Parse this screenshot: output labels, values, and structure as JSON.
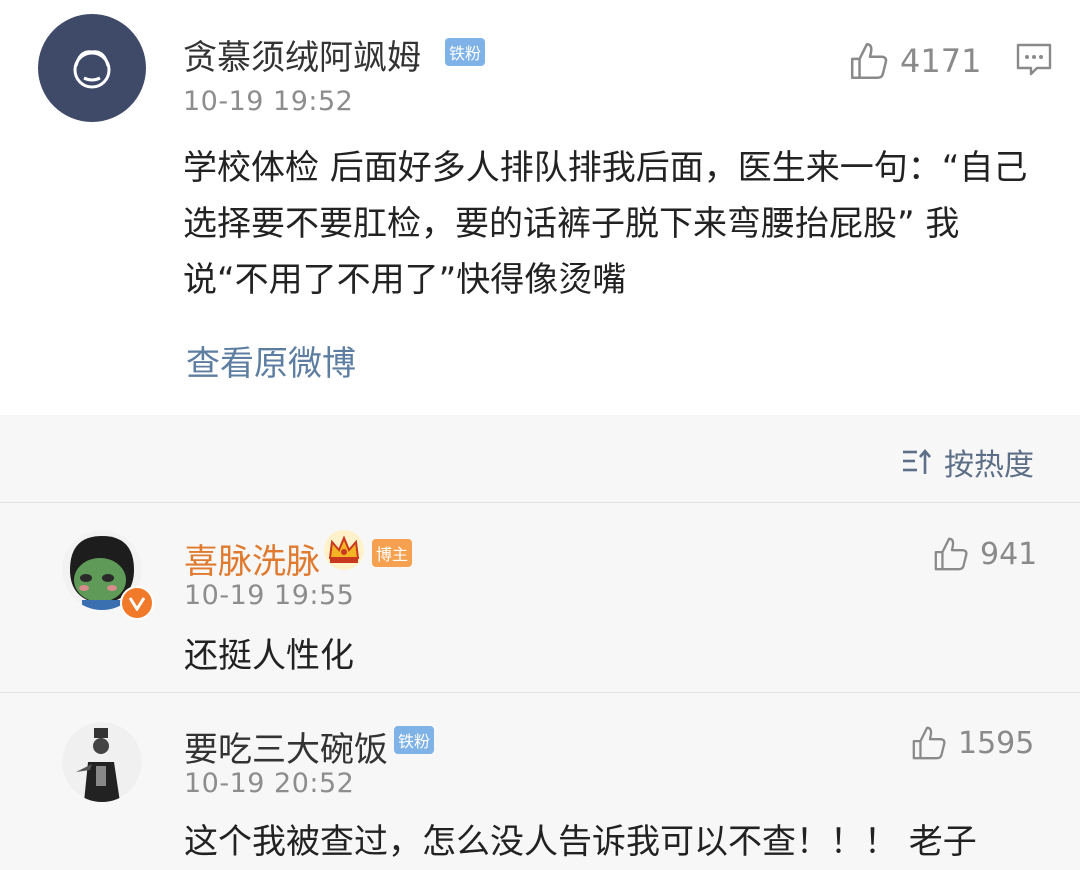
{
  "post": {
    "username": "贪慕须绒阿飒姆",
    "badge": "铁粉",
    "timestamp": "10-19 19:52",
    "likes": "4171",
    "text": "学校体检 后面好多人排队排我后面，医生来一句：“自己选择要不要肛检，要的话裤子脱下来弯腰抬屁股” 我说“不用了不用了”快得像烫嘴",
    "view_original": "查看原微博"
  },
  "sort": {
    "label": "按热度"
  },
  "comments": [
    {
      "username": "喜脉洗脉",
      "badge": "博主",
      "timestamp": "10-19 19:55",
      "likes": "941",
      "text": "还挺人性化"
    },
    {
      "username": "要吃三大碗饭",
      "badge": "铁粉",
      "timestamp": "10-19 20:52",
      "likes": "1595",
      "text": "这个我被查过，怎么没人告诉我可以不查！！！ 老子"
    }
  ],
  "colors": {
    "link": "#5e7ea1",
    "badge_blue": "#7fb2e6",
    "badge_orange": "#f5a14f",
    "username_highlight": "#e07a2f"
  }
}
